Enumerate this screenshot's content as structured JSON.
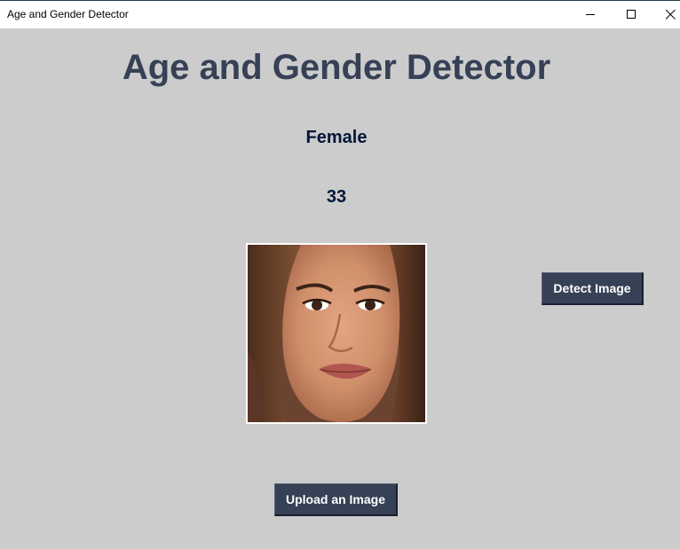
{
  "window": {
    "title": "Age and Gender Detector"
  },
  "app": {
    "heading": "Age and Gender Detector",
    "gender_result": "Female",
    "age_result": "33",
    "detect_button": "Detect Image",
    "upload_button": "Upload an Image"
  },
  "icons": {
    "minimize": "minimize-icon",
    "maximize": "maximize-icon",
    "close": "close-icon"
  },
  "colors": {
    "background": "#cccccc",
    "heading": "#364156",
    "result_text": "#011638",
    "button_bg": "#364156",
    "button_text": "#ffffff"
  }
}
